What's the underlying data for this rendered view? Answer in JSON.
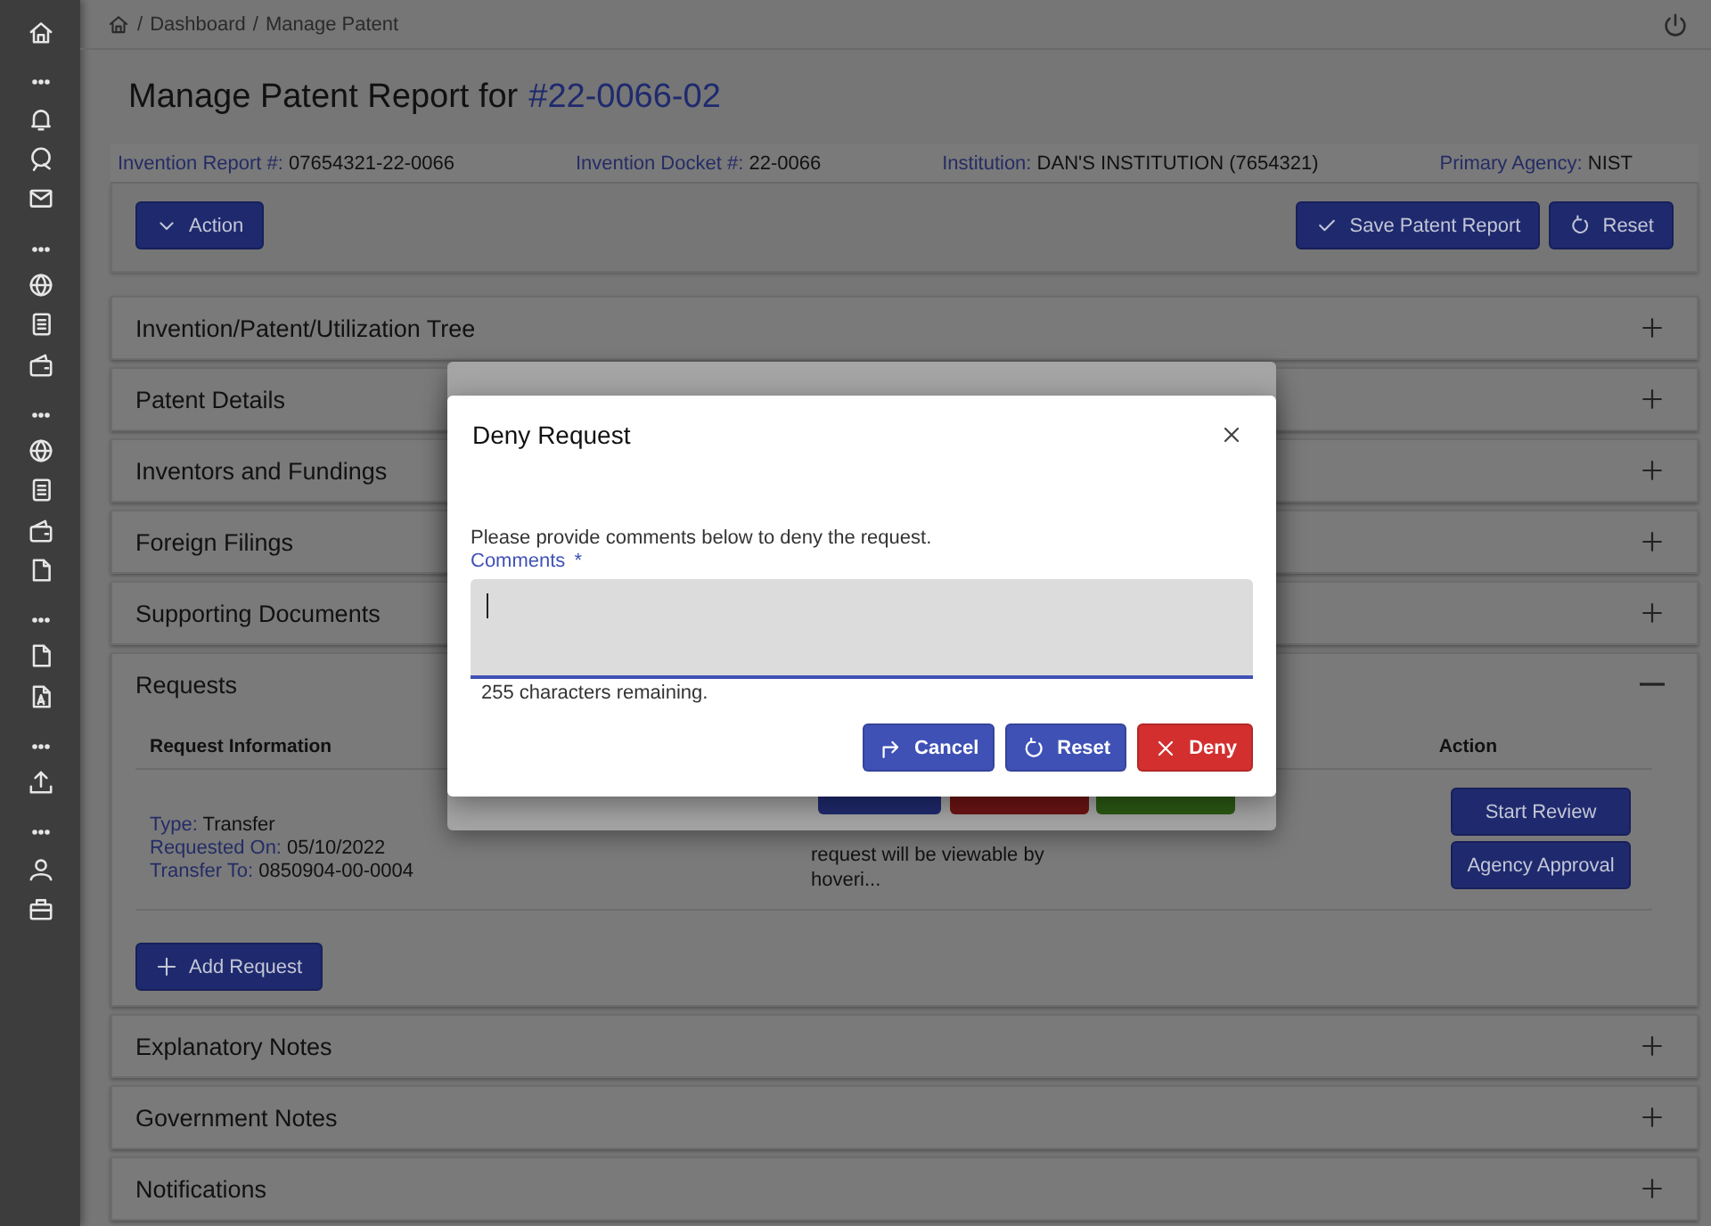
{
  "breadcrumb": {
    "separator": "/",
    "items": [
      "Dashboard",
      "Manage Patent"
    ]
  },
  "page": {
    "title": "Manage Patent Report for",
    "report_number": "#22-0066-02"
  },
  "info_bar": [
    {
      "label": "Invention Report #:",
      "value": "07654321-22-0066"
    },
    {
      "label": "Invention Docket #:",
      "value": "22-0066"
    },
    {
      "label": "Institution:",
      "value": "DAN'S INSTITUTION (7654321)"
    },
    {
      "label": "Primary Agency:",
      "value": "NIST"
    }
  ],
  "toolbar": {
    "action": "Action",
    "buttons": [
      {
        "label": "Save Patent Report",
        "kind": "save"
      },
      {
        "label": "Reset",
        "kind": "reset"
      }
    ]
  },
  "sections": [
    {
      "title": "Invention/Patent/Utilization Tree",
      "expanded": false
    },
    {
      "title": "Patent Details",
      "expanded": false
    },
    {
      "title": "Inventors and Fundings",
      "expanded": false
    },
    {
      "title": "Foreign Filings",
      "expanded": false
    },
    {
      "title": "Supporting Documents",
      "expanded": false
    },
    {
      "title": "Requests",
      "expanded": true
    },
    {
      "title": "Explanatory Notes",
      "expanded": false
    },
    {
      "title": "Government Notes",
      "expanded": false
    },
    {
      "title": "Notifications",
      "expanded": false
    }
  ],
  "requests": {
    "columns": [
      "Request Information",
      "Action"
    ],
    "rows": [
      {
        "info": [
          {
            "label": "Type:",
            "value": "Transfer"
          },
          {
            "label": "Requested On:",
            "value": "05/10/2022"
          },
          {
            "label": "Transfer To:",
            "value": "0850904-00-0004"
          }
        ],
        "note": "request will be viewable by hoveri...",
        "actions": [
          "Start Review",
          "Agency Approval"
        ]
      }
    ],
    "add_button": "Add Request"
  },
  "dialog": {
    "title": "Deny Request",
    "message": "Please provide comments below to deny the request.",
    "field": {
      "label": "Comments",
      "required_mark": "*",
      "focused": true
    },
    "counter": "255 characters remaining.",
    "buttons": [
      {
        "label": "Cancel",
        "kind": "cancel"
      },
      {
        "label": "Reset",
        "kind": "reset"
      },
      {
        "label": "Deny",
        "kind": "deny"
      }
    ]
  }
}
